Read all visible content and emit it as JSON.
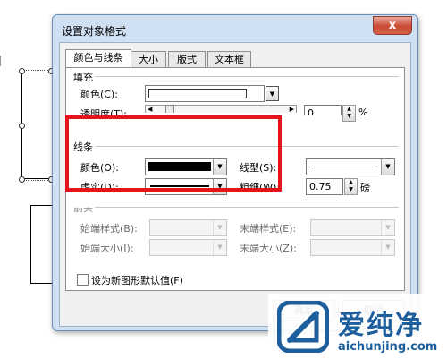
{
  "dialog": {
    "title": "设置对象格式",
    "close_label": "x",
    "tabs": [
      {
        "label": "颜色与线条",
        "active": true
      },
      {
        "label": "大小",
        "active": false
      },
      {
        "label": "版式",
        "active": false
      },
      {
        "label": "文本框",
        "active": false
      }
    ]
  },
  "fill": {
    "section_label": "填充",
    "color_label": "颜色(C):",
    "transparency_label": "透明度(T):",
    "transparency_value": "0",
    "transparency_unit": "%"
  },
  "line": {
    "section_label": "线条",
    "color_label": "颜色(O):",
    "color_value": "#000000",
    "dash_label": "虚实(D):",
    "style_label": "线型(S):",
    "weight_label": "粗细(W):",
    "weight_value": "0.75",
    "weight_unit": "磅"
  },
  "arrows": {
    "section_label": "箭头",
    "begin_style_label": "始端样式(B):",
    "begin_size_label": "始端大小(I):",
    "end_style_label": "末端样式(E):",
    "end_size_label": "末端大小(Z):"
  },
  "default_checkbox_label": "设为新图形默认值(F)",
  "buttons": {
    "ok_label": "确定",
    "cancel_label": "取消"
  },
  "watermark": {
    "cn_text": "爱纯净",
    "url_text": "aichunjing.com"
  },
  "colors": {
    "highlight": "#e5141b",
    "dialog_frame": "#cfe0f3",
    "watermark": "#1c5f9c"
  }
}
